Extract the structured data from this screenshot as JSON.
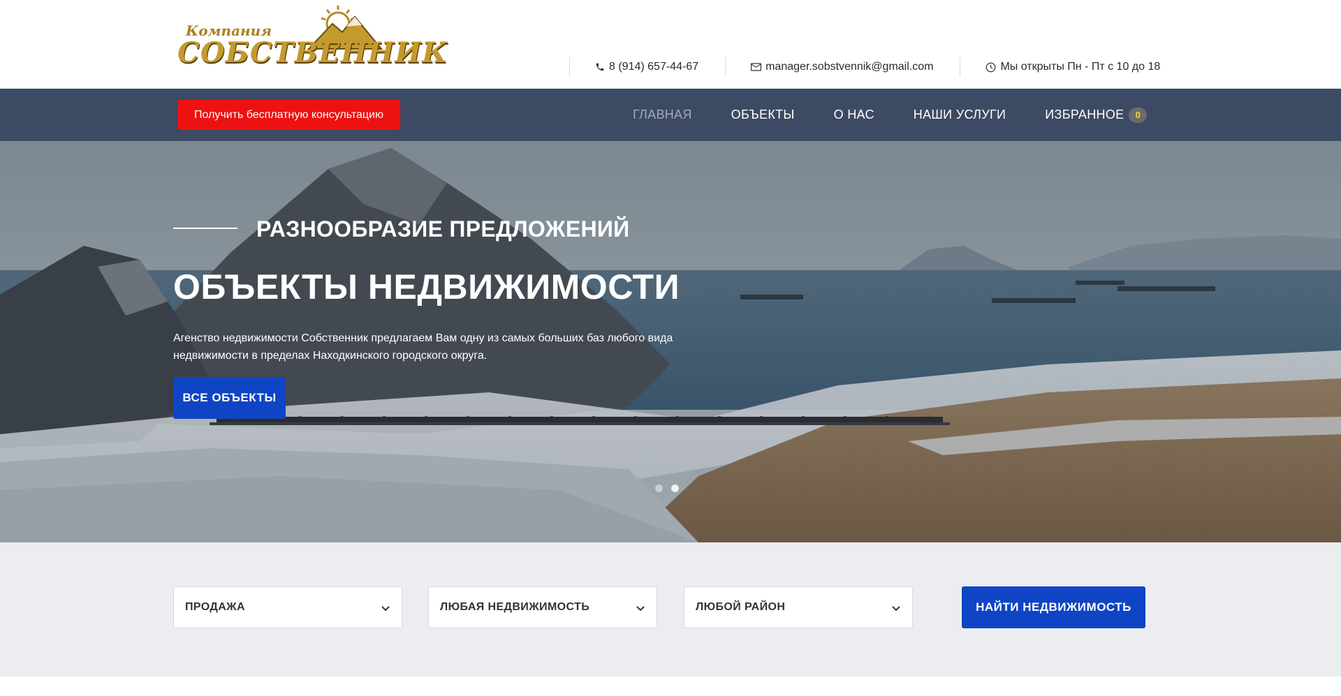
{
  "header": {
    "logo": {
      "small_text": "Компания",
      "big_text": "СОБСТВЕННИК"
    },
    "contacts": [
      {
        "icon": "phone-icon",
        "text": "8 (914) 657-44-67"
      },
      {
        "icon": "mail-icon",
        "text": "manager.sobstvennik@gmail.com"
      },
      {
        "icon": "clock-icon",
        "text": "Мы открыты Пн - Пт с 10 до 18"
      }
    ]
  },
  "nav": {
    "cta_label": "Получить бесплатную консультацию",
    "items": [
      {
        "label": "ГЛАВНАЯ",
        "active": true
      },
      {
        "label": "ОБЪЕКТЫ"
      },
      {
        "label": "О НАС"
      },
      {
        "label": "НАШИ УСЛУГИ"
      },
      {
        "label": "ИЗБРАННОЕ",
        "badge": "0"
      }
    ]
  },
  "hero": {
    "subtitle": "РАЗНООБРАЗИЕ ПРЕДЛОЖЕНИЙ",
    "title": "ОБЪЕКТЫ НЕДВИЖИМОСТИ",
    "description": "Агенство недвижимости Собственник предлагаем Вам одну из самых больших баз любого вида недвижимости в пределах Находкинского городского округа.",
    "button_label": "ВСЕ ОБЪЕКТЫ",
    "slides_count": 2,
    "active_slide": 2
  },
  "search": {
    "deal_type": "ПРОДАЖА",
    "property_type": "ЛЮБАЯ НЕДВИЖИМОСТЬ",
    "district": "ЛЮБОЙ РАЙОН",
    "button_label": "НАЙТИ НЕДВИЖИМОСТЬ"
  },
  "colors": {
    "nav_bg": "#3d4a63",
    "cta_red": "#ee1111",
    "primary_blue": "#0f45c5",
    "search_bg": "#ebedf0",
    "logo_gold": "#c39a2e"
  }
}
